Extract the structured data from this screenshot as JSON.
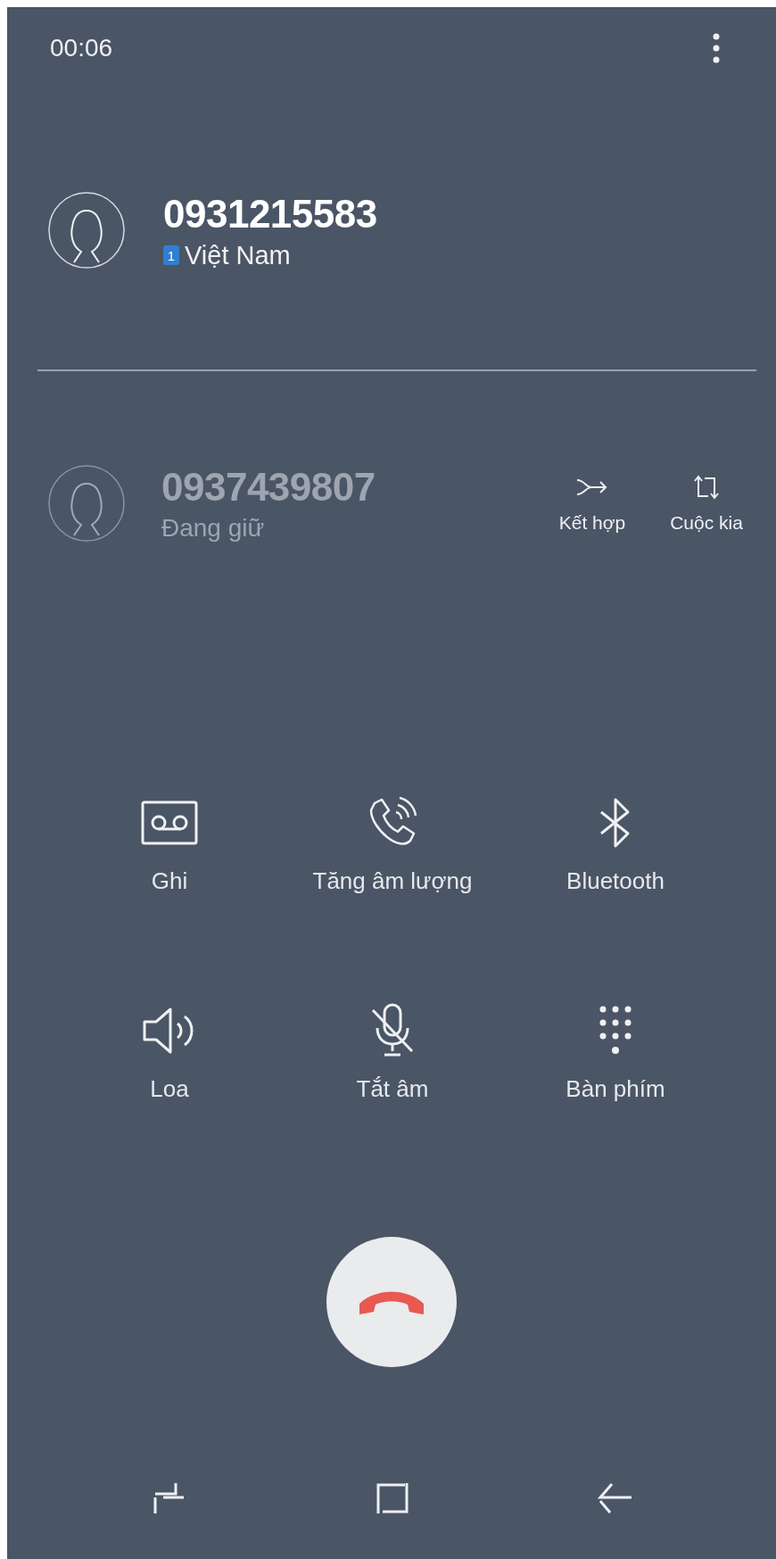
{
  "status": {
    "timer": "00:06"
  },
  "active_call": {
    "number": "0931215583",
    "sim": "1",
    "country": "Việt Nam"
  },
  "held_call": {
    "number": "0937439807",
    "status": "Đang giữ",
    "actions": [
      {
        "kind": "merge",
        "label": "Kết hợp"
      },
      {
        "kind": "swap",
        "label": "Cuộc kia"
      }
    ]
  },
  "controls": [
    {
      "kind": "record",
      "label": "Ghi"
    },
    {
      "kind": "volume",
      "label": "Tăng âm lượng"
    },
    {
      "kind": "bluetooth",
      "label": "Bluetooth"
    },
    {
      "kind": "speaker",
      "label": "Loa"
    },
    {
      "kind": "mute",
      "label": "Tắt âm"
    },
    {
      "kind": "keypad",
      "label": "Bàn phím"
    }
  ],
  "nav_bar": [
    {
      "kind": "recent"
    },
    {
      "kind": "home"
    },
    {
      "kind": "back"
    }
  ]
}
